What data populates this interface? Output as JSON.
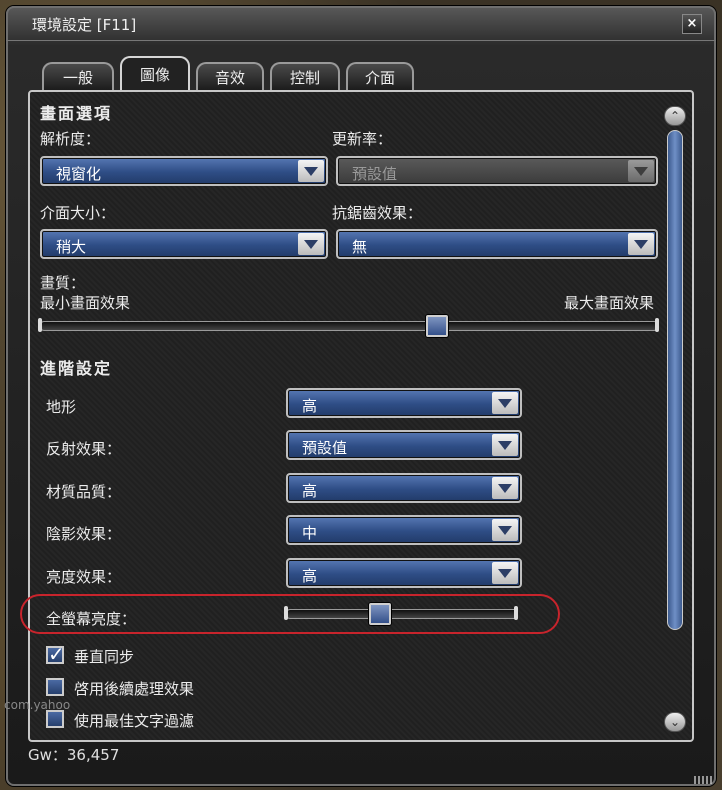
{
  "window": {
    "title": "環境設定  [F11]",
    "close_icon": "close-icon"
  },
  "tabs": [
    {
      "label": "一般"
    },
    {
      "label": "圖像"
    },
    {
      "label": "音效"
    },
    {
      "label": "控制"
    },
    {
      "label": "介面"
    }
  ],
  "active_tab": "圖像",
  "screen_options": {
    "title": "畫面選項",
    "resolution": {
      "label": "解析度：",
      "value": "視窗化"
    },
    "refresh_rate": {
      "label": "更新率：",
      "value": "預設值",
      "disabled": true
    },
    "ui_size": {
      "label": "介面大小：",
      "value": "稍大"
    },
    "antialiasing": {
      "label": "抗鋸齒效果：",
      "value": "無"
    },
    "quality": {
      "label": "畫質：",
      "min_label": "最小畫面效果",
      "max_label": "最大畫面效果",
      "level": 0.65
    }
  },
  "advanced": {
    "title": "進階設定",
    "terrain": {
      "label": "地形",
      "value": "高"
    },
    "reflection": {
      "label": "反射效果：",
      "value": "預設值"
    },
    "texture": {
      "label": "材質品質：",
      "value": "高"
    },
    "shadow": {
      "label": "陰影效果：",
      "value": "中"
    },
    "brightness": {
      "label": "亮度效果：",
      "value": "高"
    },
    "fullscreen_brightness": {
      "label": "全螢幕亮度：",
      "level": 0.4
    }
  },
  "checkboxes": [
    {
      "label": "垂直同步",
      "checked": true
    },
    {
      "label": "啓用後續處理效果",
      "checked": false
    },
    {
      "label": "使用最佳文字過濾",
      "checked": false
    }
  ],
  "footer": {
    "gw": "Gw：36,457"
  },
  "watermark": "com.yahoo"
}
